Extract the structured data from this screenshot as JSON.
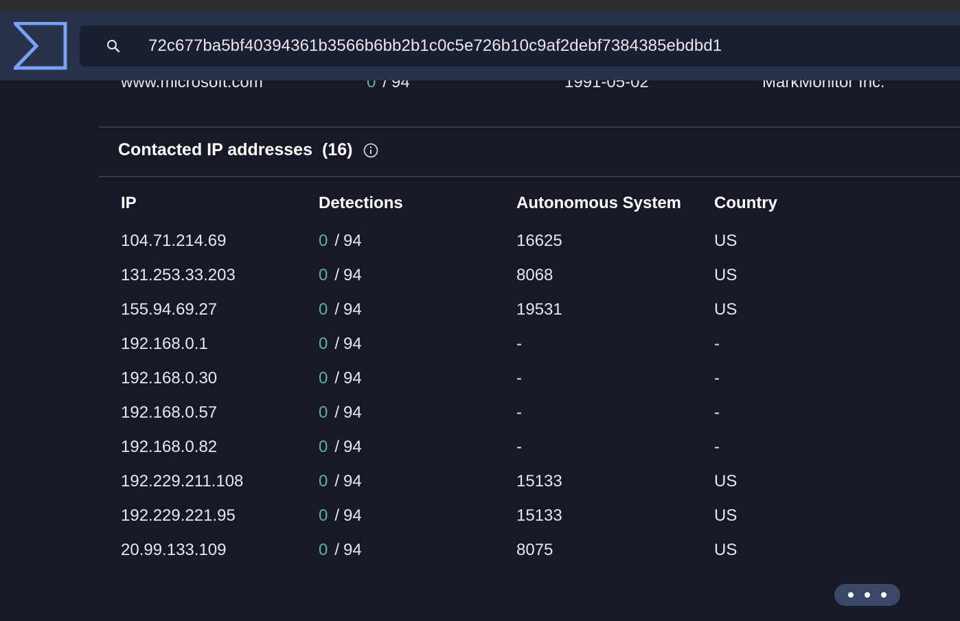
{
  "header": {
    "search_value": "72c677ba5bf40394361b3566b6bb2b1c0c5e726b10c9af2debf7384385ebdbd1"
  },
  "previous_row": {
    "domain": "www.microsoft.com",
    "detections_positive": "0",
    "detections_total": "94",
    "created": "1991-05-02",
    "registrar": "MarkMonitor Inc."
  },
  "section": {
    "title": "Contacted IP addresses",
    "count": "(16)"
  },
  "table": {
    "columns": [
      "IP",
      "Detections",
      "Autonomous System",
      "Country"
    ],
    "rows": [
      {
        "ip": "104.71.214.69",
        "positive": "0",
        "total": "94",
        "as": "16625",
        "country": "US"
      },
      {
        "ip": "131.253.33.203",
        "positive": "0",
        "total": "94",
        "as": "8068",
        "country": "US"
      },
      {
        "ip": "155.94.69.27",
        "positive": "0",
        "total": "94",
        "as": "19531",
        "country": "US"
      },
      {
        "ip": "192.168.0.1",
        "positive": "0",
        "total": "94",
        "as": "-",
        "country": "-"
      },
      {
        "ip": "192.168.0.30",
        "positive": "0",
        "total": "94",
        "as": "-",
        "country": "-"
      },
      {
        "ip": "192.168.0.57",
        "positive": "0",
        "total": "94",
        "as": "-",
        "country": "-"
      },
      {
        "ip": "192.168.0.82",
        "positive": "0",
        "total": "94",
        "as": "-",
        "country": "-"
      },
      {
        "ip": "192.229.211.108",
        "positive": "0",
        "total": "94",
        "as": "15133",
        "country": "US"
      },
      {
        "ip": "192.229.221.95",
        "positive": "0",
        "total": "94",
        "as": "15133",
        "country": "US"
      },
      {
        "ip": "20.99.133.109",
        "positive": "0",
        "total": "94",
        "as": "8075",
        "country": "US"
      }
    ]
  },
  "colors": {
    "background": "#181926",
    "header": "#28324b",
    "accent_logo": "#7aa2f7",
    "clean_green": "#58b894"
  },
  "icons": {
    "logo": "sigma-logo-icon",
    "search": "search-icon",
    "info": "info-icon",
    "more": "more-dots-icon"
  }
}
